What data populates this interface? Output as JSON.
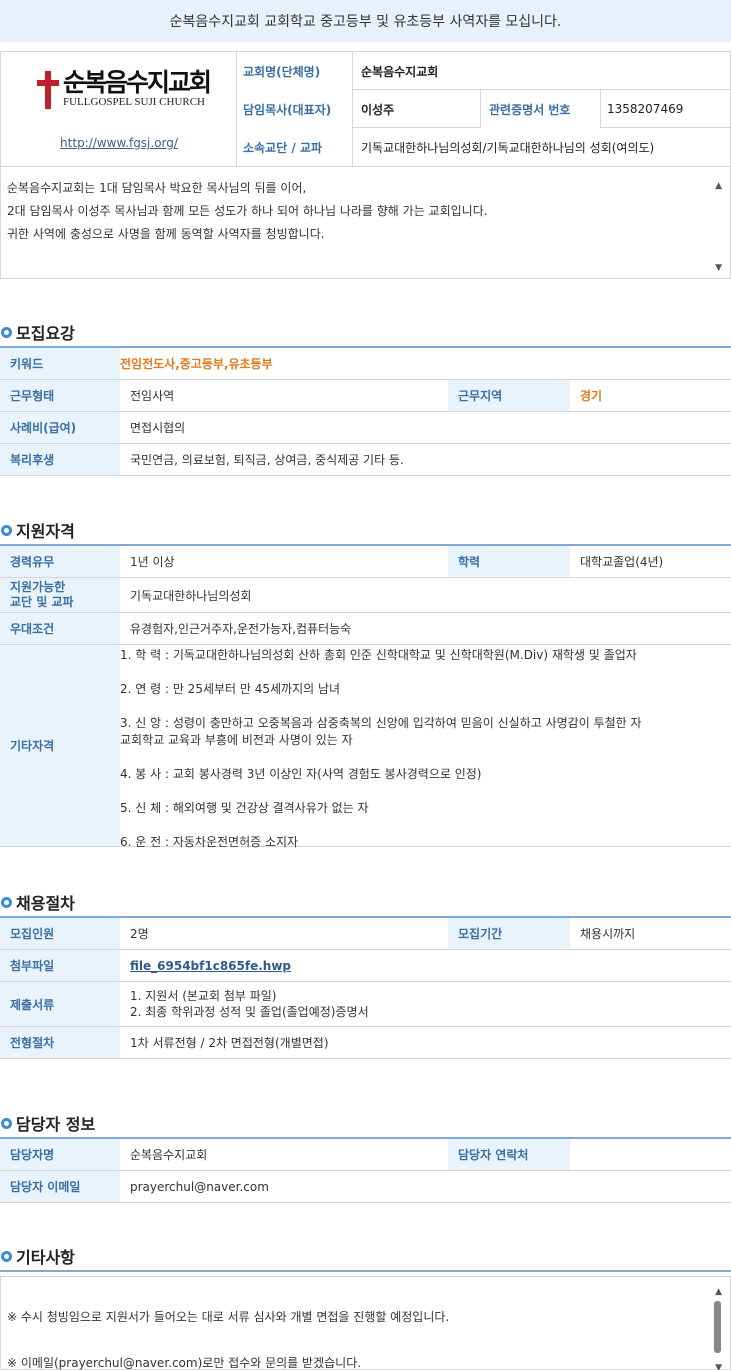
{
  "banner": {
    "title": "순복음수지교회 교회학교 중고등부 및 유초등부 사역자를 모십니다."
  },
  "church": {
    "logo_ko": "순복음수지교회",
    "logo_en": "FULLGOSPEL SUJI CHURCH",
    "homepage": "http://www.fgsj.org/",
    "rows": [
      {
        "label": "교회명(단체명)",
        "value": "순복음수지교회"
      },
      {
        "label": "담임목사(대표자)",
        "value": "이성주",
        "label2": "관련증명서 번호",
        "value2": "1358207469"
      },
      {
        "label": "소속교단 / 교파",
        "value": "기독교대한하나님의성회/기독교대한하나님의 성회(여의도)"
      }
    ]
  },
  "intro": {
    "lines": [
      "순복음수지교회는 1대 담임목사 박요한 목사님의 뒤를 이어,",
      "2대 담임목사 이성주 목사님과 함께 모든 성도가 하나 되어 하나님 나라를 향해 가는 교회입니다.",
      "귀한 사역에 충성으로 사명을 함께 동역할 사역자를 청빙합니다."
    ]
  },
  "recruit": {
    "title": "모집요강",
    "keyword_label": "키워드",
    "keyword": "전임전도사,중고등부,유초등부",
    "type_label": "근무형태",
    "type": "전임사역",
    "region_label": "근무지역",
    "region": "경기",
    "pay_label": "사례비(급여)",
    "pay": "면접시협의",
    "welfare_label": "복리후생",
    "welfare": "국민연금, 의료보험, 퇴직금, 상여금, 중식제공 기타 등."
  },
  "qualify": {
    "title": "지원자격",
    "career_label": "경력유무",
    "career": "1년 이상",
    "edu_label": "학력",
    "edu": "대학교졸업(4년)",
    "denom_label": "지원가능한\n교단 및 교파",
    "denom": "기독교대한하나님의성회",
    "pref_label": "우대조건",
    "pref": "유경험자,인근거주자,운전가능자,컴퓨터능숙",
    "etc_label": "기타자격",
    "etc": "1. 학 력 : 기독교대한하나님의성회 산하 총회 인준 신학대학교 및 신학대학원(M.Div) 재학생 및 졸업자\n\n2. 연 령 : 만 25세부터 만 45세까지의 남녀\n\n3. 신 앙 : 성령이 충만하고 오중복음과 삼중축복의 신앙에 입각하여 믿음이 신실하고 사명감이 투철한 자\n교회학교 교육과 부흥에 비전과 사명이 있는 자\n\n4. 봉 사 : 교회 봉사경력 3년 이상인 자(사역 경험도 봉사경력으로 인정)\n\n5. 신 체 : 해외여행 및 건강상 결격사유가 없는 자\n\n6. 운 전 : 자동차운전면허증 소지자"
  },
  "process": {
    "title": "채용절차",
    "count_label": "모집인원",
    "count": "2명",
    "period_label": "모집기간",
    "period": "채용시까지",
    "file_label": "첨부파일",
    "file": "file_6954bf1c865fe.hwp",
    "docs_label": "제출서류",
    "docs": "1. 지원서 (본교회 첨부 파일)\n2. 최종 학위과정 성적 및 졸업(졸업예정)증명서",
    "step_label": "전형절차",
    "step": "1차 서류전형 / 2차 면접전형(개별면접)"
  },
  "contact": {
    "title": "담당자 정보",
    "name_label": "담당자명",
    "name": "순복음수지교회",
    "phone_label": "담당자 연락처",
    "phone": "",
    "email_label": "담당자 이메일",
    "email": "prayerchul@naver.com"
  },
  "etc": {
    "title": "기타사항",
    "text": "※ 수시 청빙임으로 지원서가 들어오는 대로 서류 심사와 개별 면접을 진행할 예정입니다.\n\n※ 이메일(prayerchul@naver.com)로만 접수와 문의를 받겠습니다."
  },
  "colors": {
    "accent": "#3d8ad6",
    "header_bg": "#e8f3fc",
    "keyword": "#e07a1f",
    "logo_red": "#c21f2e"
  }
}
